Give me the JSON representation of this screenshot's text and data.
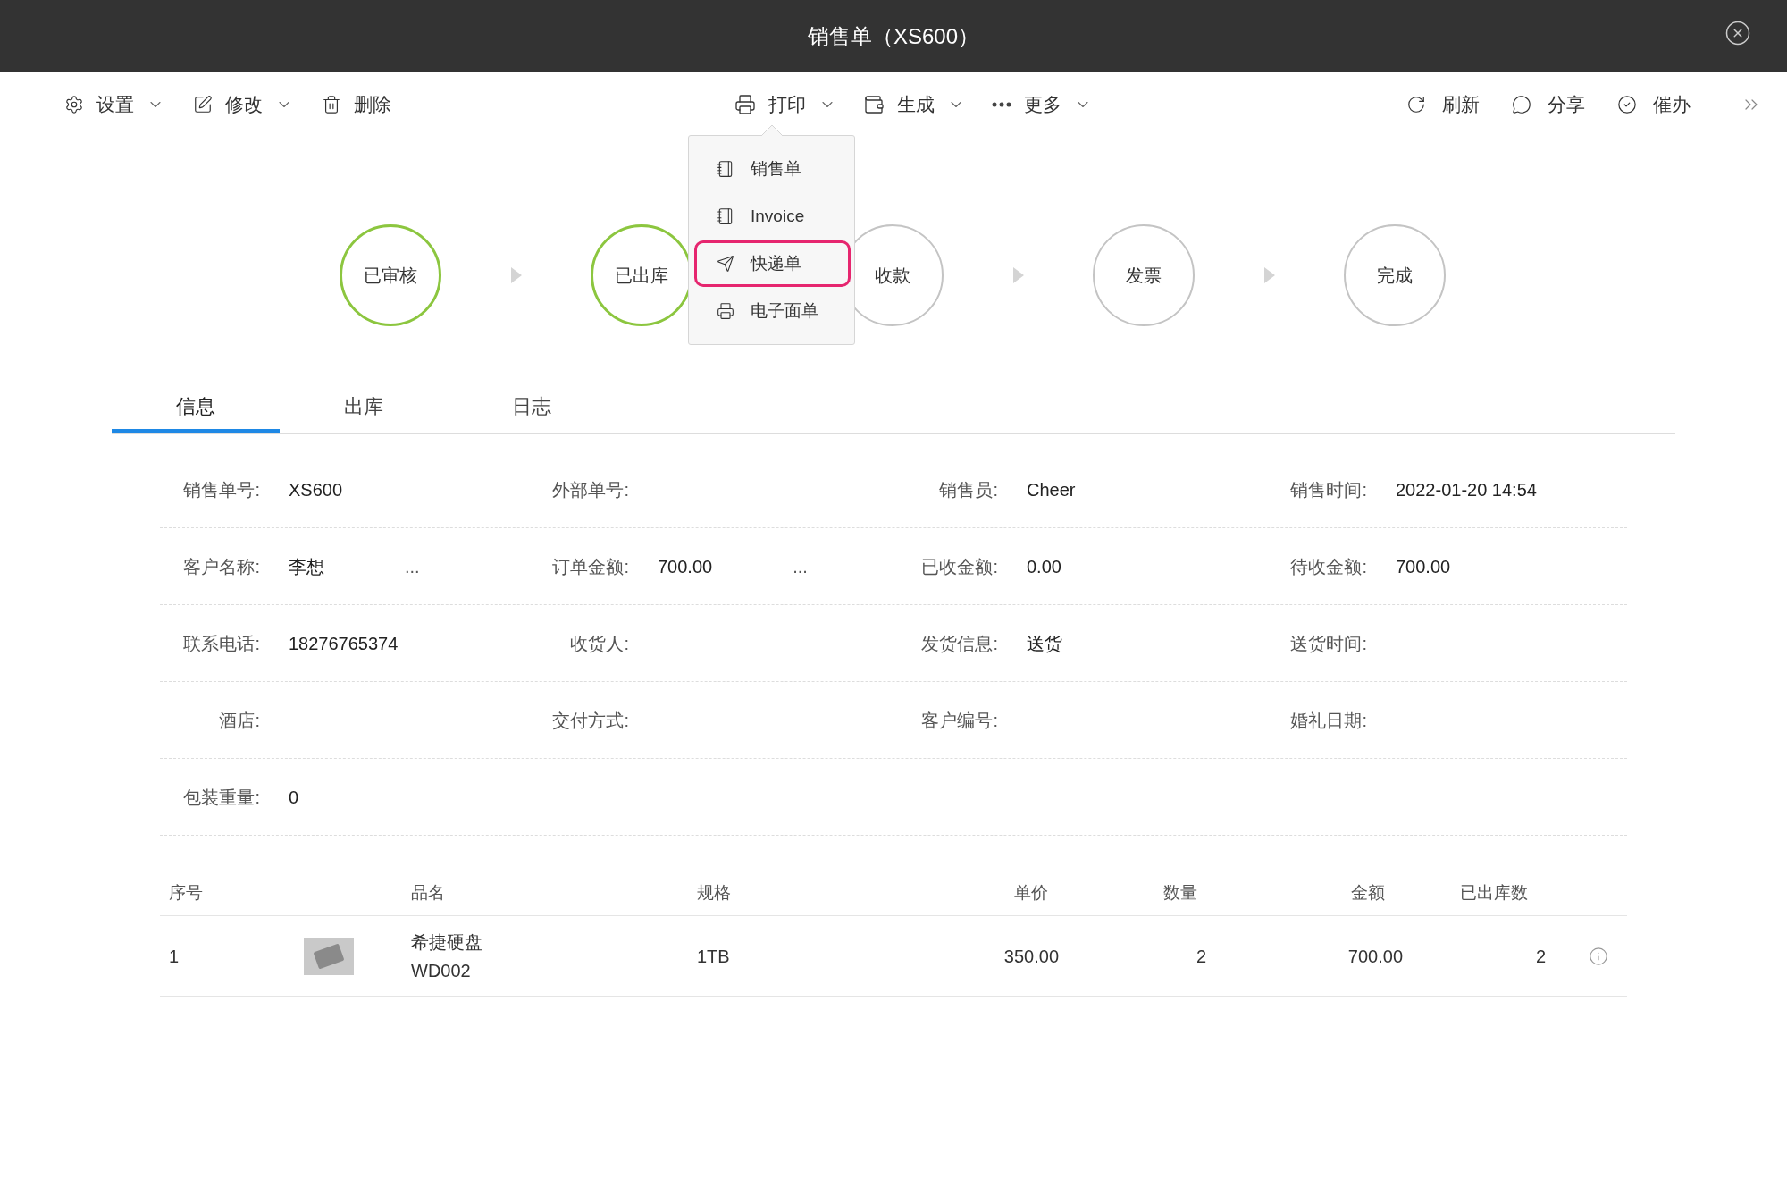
{
  "window": {
    "title": "销售单（XS600）"
  },
  "toolbar": {
    "left": [
      {
        "label": "设置",
        "has_menu": true
      },
      {
        "label": "修改",
        "has_menu": true
      },
      {
        "label": "删除",
        "has_menu": false
      }
    ],
    "center": [
      {
        "label": "打印",
        "has_menu": true,
        "menu": [
          {
            "label": "销售单",
            "selected": false
          },
          {
            "label": "Invoice",
            "selected": false
          },
          {
            "label": "快递单",
            "selected": true
          },
          {
            "label": "电子面单",
            "selected": false
          }
        ]
      },
      {
        "label": "生成",
        "has_menu": true
      },
      {
        "label": "更多",
        "has_menu": true
      }
    ],
    "right": [
      {
        "label": "刷新"
      },
      {
        "label": "分享"
      },
      {
        "label": "催办"
      }
    ]
  },
  "steps": [
    {
      "label": "已审核",
      "done": true
    },
    {
      "label": "已出库",
      "done": true
    },
    {
      "label": "收款",
      "done": false
    },
    {
      "label": "发票",
      "done": false
    },
    {
      "label": "完成",
      "done": false
    }
  ],
  "tabs": [
    {
      "label": "信息",
      "selected": true
    },
    {
      "label": "出库",
      "selected": false
    },
    {
      "label": "日志",
      "selected": false
    }
  ],
  "fields": [
    [
      {
        "label": "销售单号:",
        "value": "XS600"
      },
      {
        "label": "外部单号:"
      },
      {
        "label": "销售员:",
        "value": "Cheer"
      },
      {
        "label": "销售时间:",
        "value": "2022-01-20 14:54"
      }
    ],
    [
      {
        "label": "客户名称:",
        "value": "李想",
        "more": "..."
      },
      {
        "label": "订单金额:",
        "value": "700.00",
        "more": "..."
      },
      {
        "label": "已收金额:",
        "value": "0.00"
      },
      {
        "label": "待收金额:",
        "value": "700.00"
      }
    ],
    [
      {
        "label": "联系电话:",
        "value": "18276765374"
      },
      {
        "label": "收货人:"
      },
      {
        "label": "发货信息:",
        "value": "送货"
      },
      {
        "label": "送货时间:"
      }
    ],
    [
      {
        "label": "酒店:"
      },
      {
        "label": "交付方式:"
      },
      {
        "label": "客户编号:"
      },
      {
        "label": "婚礼日期:"
      }
    ],
    [
      {
        "label": "包装重量:",
        "value": "0"
      }
    ]
  ],
  "table": {
    "columns": [
      "序号",
      "品名",
      "规格",
      "单价",
      "数量",
      "金额",
      "已出库数"
    ],
    "rows": [
      {
        "index": "1",
        "name": "希捷硬盘",
        "code": "WD002",
        "spec": "1TB",
        "price": "350.00",
        "qty": "2",
        "amount": "700.00",
        "shipped": "2"
      }
    ]
  }
}
